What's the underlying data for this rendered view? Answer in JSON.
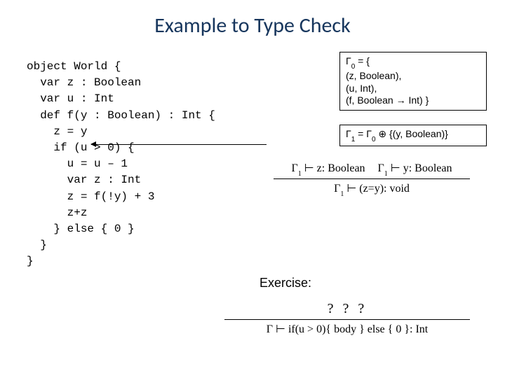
{
  "title": "Example to Type Check",
  "code": "object World {\n  var z : Boolean\n  var u : Int\n  def f(y : Boolean) : Int {\n    z = y\n    if (u > 0) {\n      u = u – 1\n      var z : Int\n      z = f(!y) + 3\n      z+z\n    } else { 0 }\n  }\n}",
  "gamma0": {
    "head": "Γ",
    "sub": "0",
    "eq": " = {",
    "l1": "  (z, Boolean),",
    "l2": "  (u, Int),",
    "l3": "  (f, Boolean → Int) }"
  },
  "gamma1": {
    "text_a": "Γ",
    "sub_a": "1",
    "text_b": " = Γ",
    "sub_b": "0",
    "text_c": " ⊕ {(y, Boolean)}"
  },
  "rule1": {
    "num_left_a": "Γ",
    "num_left_sub": "1",
    "num_left_b": " ⊢ z: Boolean",
    "num_right_a": "Γ",
    "num_right_sub": "1",
    "num_right_b": " ⊢ y: Boolean",
    "den_a": "Γ",
    "den_sub": "1",
    "den_b": " ⊢ (z=y): void"
  },
  "exercise": "Exercise:",
  "rule2": {
    "num": "? ? ?",
    "den": "Γ ⊢ if(u > 0){ body } else { 0 }: Int"
  }
}
